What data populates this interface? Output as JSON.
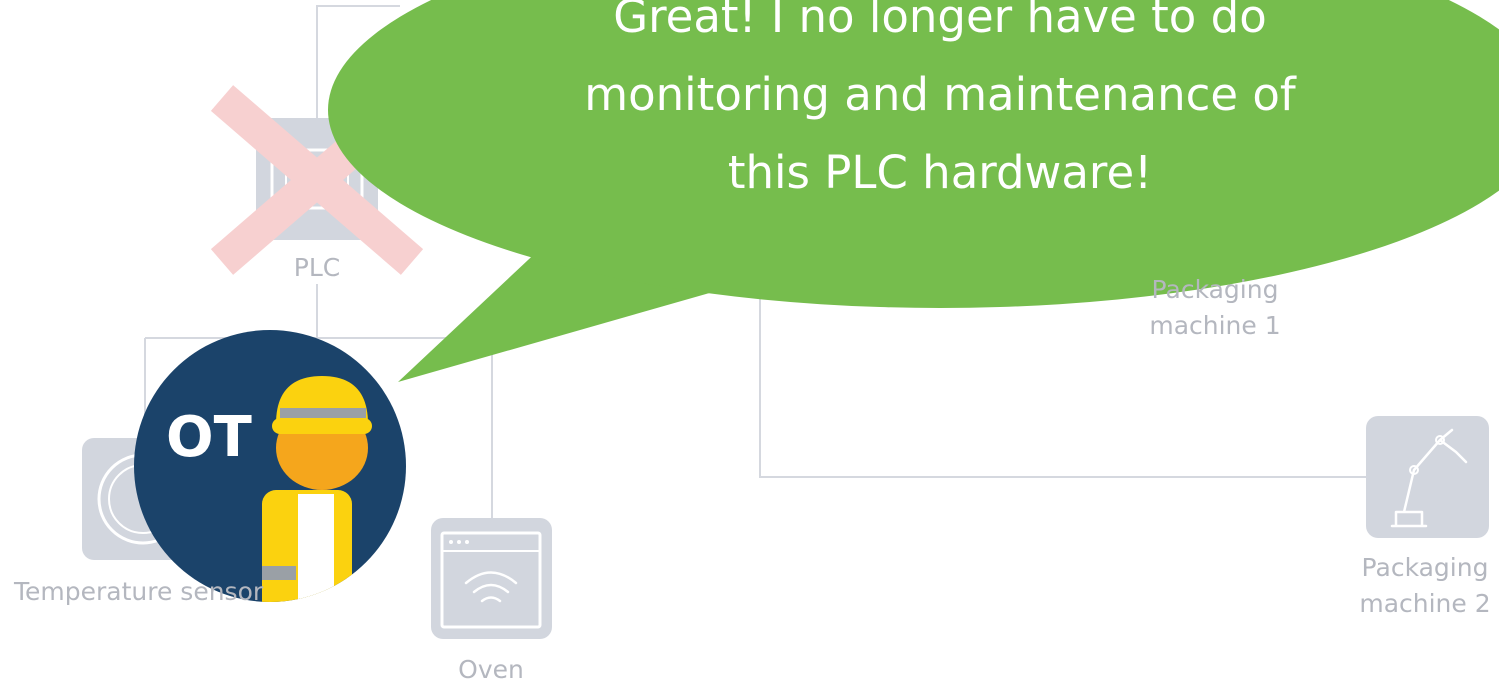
{
  "speech_bubble": {
    "lines": [
      "Great! I no longer have to do",
      "monitoring and maintenance of",
      "this PLC hardware!"
    ]
  },
  "nodes": {
    "plc": {
      "label": "PLC",
      "status": "removed"
    },
    "temperature_sensor": {
      "label": "Temperature sensor"
    },
    "oven": {
      "label": "Oven"
    },
    "packaging_machine_1": {
      "label_lines": [
        "Packaging",
        "machine 1"
      ]
    },
    "packaging_machine_2": {
      "label_lines": [
        "Packaging",
        "machine 2"
      ]
    }
  },
  "persona": {
    "badge": "OT"
  },
  "colors": {
    "bubble": "#76bd4d",
    "persona_circle": "#1b436a",
    "helmet": "#fbd20f",
    "face": "#f5a61c",
    "vest": "#fbd20f",
    "cross": "#f7d0d0",
    "device_tile": "#d2d6de",
    "connector": "#d5d8df",
    "label": "#b4b7bf"
  }
}
